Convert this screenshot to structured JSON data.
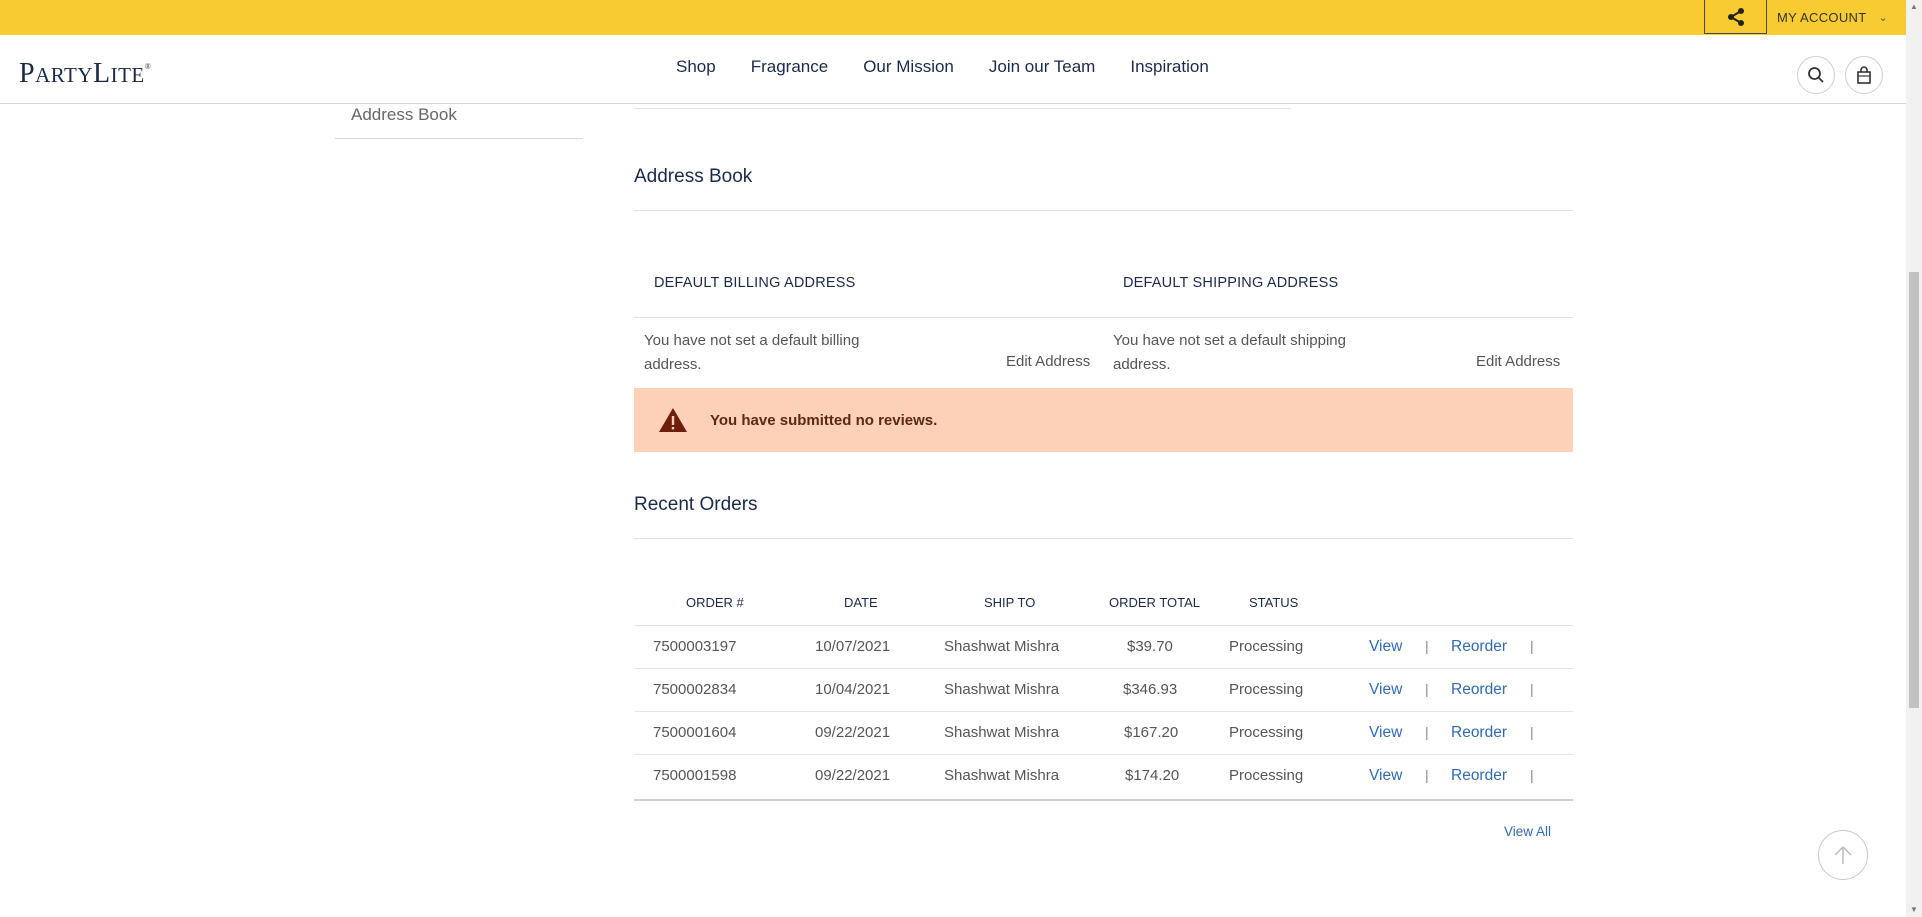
{
  "topbar": {
    "account_label": "MY ACCOUNT"
  },
  "header": {
    "logo_text": "PartyLite",
    "nav": [
      "Shop",
      "Fragrance",
      "Our Mission",
      "Join our Team",
      "Inspiration"
    ]
  },
  "sidebar": {
    "active_item": "Address Book"
  },
  "address_book": {
    "title": "Address Book",
    "billing": {
      "heading": "DEFAULT BILLING ADDRESS",
      "text": "You have not set a default billing address.",
      "edit_label": "Edit Address"
    },
    "shipping": {
      "heading": "DEFAULT SHIPPING ADDRESS",
      "text": "You have not set a default shipping address.",
      "edit_label": "Edit Address"
    }
  },
  "alert": {
    "message": "You have submitted no reviews."
  },
  "recent_orders": {
    "title": "Recent Orders",
    "columns": [
      "ORDER #",
      "DATE",
      "SHIP TO",
      "ORDER TOTAL",
      "STATUS"
    ],
    "rows": [
      {
        "order": "7500003197",
        "date": "10/07/2021",
        "ship_to": "Shashwat Mishra",
        "total": "$39.70",
        "status": "Processing",
        "view": "View",
        "reorder": "Reorder"
      },
      {
        "order": "7500002834",
        "date": "10/04/2021",
        "ship_to": "Shashwat Mishra",
        "total": "$346.93",
        "status": "Processing",
        "view": "View",
        "reorder": "Reorder"
      },
      {
        "order": "7500001604",
        "date": "09/22/2021",
        "ship_to": "Shashwat Mishra",
        "total": "$167.20",
        "status": "Processing",
        "view": "View",
        "reorder": "Reorder"
      },
      {
        "order": "7500001598",
        "date": "09/22/2021",
        "ship_to": "Shashwat Mishra",
        "total": "$174.20",
        "status": "Processing",
        "view": "View",
        "reorder": "Reorder"
      }
    ],
    "separator": "|",
    "view_all_label": "View All"
  },
  "colors": {
    "topbar": "#f9cb32",
    "alert_bg": "#fdd1b8",
    "link": "#2f6ab3",
    "navy": "#1b2a4a"
  }
}
